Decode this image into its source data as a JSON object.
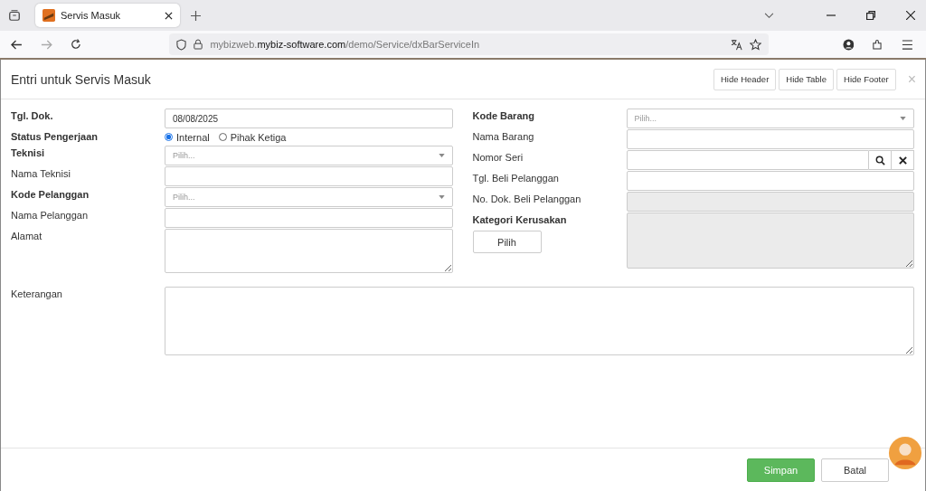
{
  "browser": {
    "tab": {
      "title": "Servis Masuk",
      "selected": true
    },
    "url": "mybizweb.**mybiz-software.com**/demo/Service/dxBarServiceIn"
  },
  "modal": {
    "title": "Entri untuk Servis Masuk",
    "header_buttons": [
      "Hide Header",
      "Hide Table",
      "Hide Footer"
    ],
    "close": "×",
    "left_fields": [
      {
        "label": "Tgl. Dok.",
        "required": true,
        "kind": "text",
        "value": "08/08/2025"
      },
      {
        "label": "Status Pengerjaan",
        "required": true,
        "kind": "radio",
        "options": [
          {
            "label": "Internal",
            "selected": true
          },
          {
            "label": "Pihak Ketiga",
            "selected": false
          }
        ]
      },
      {
        "label": "Teknisi",
        "required": true,
        "kind": "select",
        "placeholder": "Pilih..."
      },
      {
        "label": "Nama Teknisi",
        "required": false,
        "kind": "text"
      },
      {
        "label": "Kode Pelanggan",
        "required": true,
        "kind": "select",
        "placeholder": "Pilih..."
      },
      {
        "label": "Nama Pelanggan",
        "required": false,
        "kind": "text"
      },
      {
        "label": "Alamat",
        "required": false,
        "kind": "textarea",
        "disabled": false
      }
    ],
    "right_fields": [
      {
        "label": "Kode Barang",
        "required": true,
        "kind": "select",
        "placeholder": "Pilih..."
      },
      {
        "label": "Nama Barang",
        "required": false,
        "kind": "text"
      },
      {
        "label": "Nomor Seri",
        "required": false,
        "kind": "search"
      },
      {
        "label": "Tgl. Beli Pelanggan",
        "required": false,
        "kind": "text"
      },
      {
        "label": "No. Dok. Beli Pelanggan",
        "required": false,
        "kind": "text",
        "disabled": true
      },
      {
        "label": "Kategori Kerusakan",
        "required": true,
        "kind": "textarea",
        "disabled": true,
        "button": "Pilih"
      }
    ],
    "note": {
      "label": "Keterangan",
      "required": false
    },
    "footer_buttons": [
      {
        "label": "Simpan",
        "kind": "primary"
      },
      {
        "label": "Batal",
        "kind": "default"
      }
    ]
  }
}
